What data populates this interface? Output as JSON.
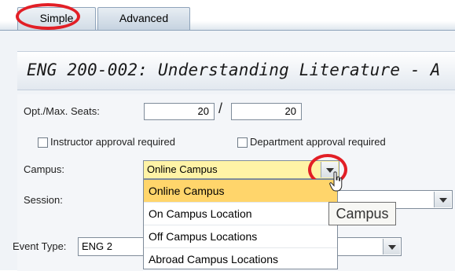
{
  "tabs": [
    {
      "label": "Simple",
      "active": true,
      "highlighted": true
    },
    {
      "label": "Advanced",
      "active": false
    }
  ],
  "title": "ENG 200-002: Understanding Literature - A",
  "form": {
    "seats_label": "Opt./Max. Seats:",
    "opt_seats": "20",
    "separator": "/",
    "max_seats": "20",
    "instructor_approval_label": "Instructor approval required",
    "instructor_approval_checked": false,
    "department_approval_label": "Department approval required",
    "department_approval_checked": false,
    "campus_label": "Campus:",
    "campus_value": "Online Campus",
    "session_label": "Session:",
    "session_value": "",
    "event_type_label": "Event Type:",
    "event_type_value": "ENG 2"
  },
  "campus_dropdown": {
    "open": true,
    "options": [
      "Online Campus",
      "On Campus Location",
      "Off Campus Locations",
      "Abroad Campus Locations"
    ],
    "selected_index": 0
  },
  "tooltip": "Campus",
  "colors": {
    "highlight_circle": "#e21f26",
    "selected_option": "#ffd56b",
    "active_field": "#fff3a6"
  },
  "icons": [
    "chevron-down-icon",
    "pointer-cursor-icon"
  ]
}
